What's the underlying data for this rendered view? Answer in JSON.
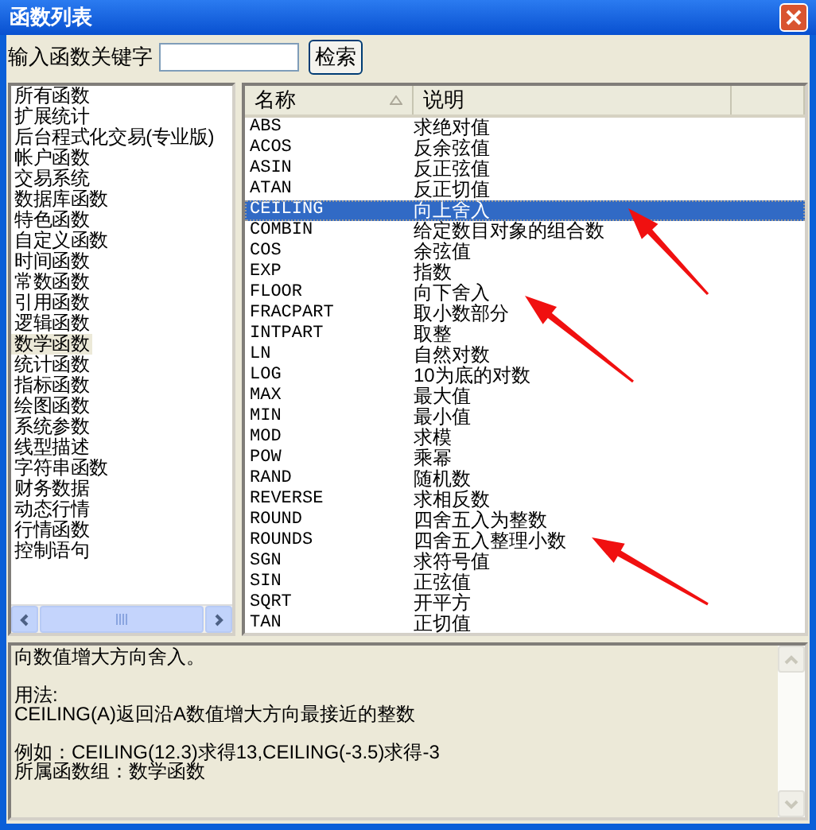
{
  "window": {
    "title": "函数列表"
  },
  "search": {
    "label": "输入函数关键字",
    "button": "检索"
  },
  "categories": [
    {
      "label": "所有函数",
      "selected": false
    },
    {
      "label": "扩展统计",
      "selected": false
    },
    {
      "label": "后台程式化交易(专业版)",
      "selected": false
    },
    {
      "label": "帐户函数",
      "selected": false
    },
    {
      "label": "交易系统",
      "selected": false
    },
    {
      "label": "数据库函数",
      "selected": false
    },
    {
      "label": "特色函数",
      "selected": false
    },
    {
      "label": "自定义函数",
      "selected": false
    },
    {
      "label": "时间函数",
      "selected": false
    },
    {
      "label": "常数函数",
      "selected": false
    },
    {
      "label": "引用函数",
      "selected": false
    },
    {
      "label": "逻辑函数",
      "selected": false
    },
    {
      "label": "数学函数",
      "selected": true
    },
    {
      "label": "统计函数",
      "selected": false
    },
    {
      "label": "指标函数",
      "selected": false
    },
    {
      "label": "绘图函数",
      "selected": false
    },
    {
      "label": "系统参数",
      "selected": false
    },
    {
      "label": "线型描述",
      "selected": false
    },
    {
      "label": "字符串函数",
      "selected": false
    },
    {
      "label": "财务数据",
      "selected": false
    },
    {
      "label": "动态行情",
      "selected": false
    },
    {
      "label": "行情函数",
      "selected": false
    },
    {
      "label": "控制语句",
      "selected": false
    }
  ],
  "table": {
    "columns": [
      {
        "label": "名称",
        "sorted": true
      },
      {
        "label": "说明",
        "sorted": false
      }
    ],
    "rows": [
      {
        "name": "ABS",
        "description": "求绝对值",
        "selected": false
      },
      {
        "name": "ACOS",
        "description": "反余弦值",
        "selected": false
      },
      {
        "name": "ASIN",
        "description": "反正弦值",
        "selected": false
      },
      {
        "name": "ATAN",
        "description": "反正切值",
        "selected": false
      },
      {
        "name": "CEILING",
        "description": "向上舍入",
        "selected": true
      },
      {
        "name": "COMBIN",
        "description": "给定数目对象的组合数",
        "selected": false
      },
      {
        "name": "COS",
        "description": "余弦值",
        "selected": false
      },
      {
        "name": "EXP",
        "description": "指数",
        "selected": false
      },
      {
        "name": "FLOOR",
        "description": "向下舍入",
        "selected": false
      },
      {
        "name": "FRACPART",
        "description": "取小数部分",
        "selected": false
      },
      {
        "name": "INTPART",
        "description": "取整",
        "selected": false
      },
      {
        "name": "LN",
        "description": "自然对数",
        "selected": false
      },
      {
        "name": "LOG",
        "description": "10为底的对数",
        "selected": false
      },
      {
        "name": "MAX",
        "description": "最大值",
        "selected": false
      },
      {
        "name": "MIN",
        "description": "最小值",
        "selected": false
      },
      {
        "name": "MOD",
        "description": "求模",
        "selected": false
      },
      {
        "name": "POW",
        "description": "乘幂",
        "selected": false
      },
      {
        "name": "RAND",
        "description": "随机数",
        "selected": false
      },
      {
        "name": "REVERSE",
        "description": "求相反数",
        "selected": false
      },
      {
        "name": "ROUND",
        "description": "四舍五入为整数",
        "selected": false
      },
      {
        "name": "ROUNDS",
        "description": "四舍五入整理小数",
        "selected": false
      },
      {
        "name": "SGN",
        "description": "求符号值",
        "selected": false
      },
      {
        "name": "SIN",
        "description": "正弦值",
        "selected": false
      },
      {
        "name": "SQRT",
        "description": "开平方",
        "selected": false
      },
      {
        "name": "TAN",
        "description": "正切值",
        "selected": false
      }
    ]
  },
  "description": {
    "paragraphs": [
      [
        "向数值增大方向舍入。"
      ],
      [
        "用法:",
        "CEILING(A)返回沿A数值增大方向最接近的整数"
      ],
      [
        "例如：CEILING(12.3)求得13,CEILING(-3.5)求得-3",
        "所属函数组：数学函数"
      ]
    ]
  }
}
